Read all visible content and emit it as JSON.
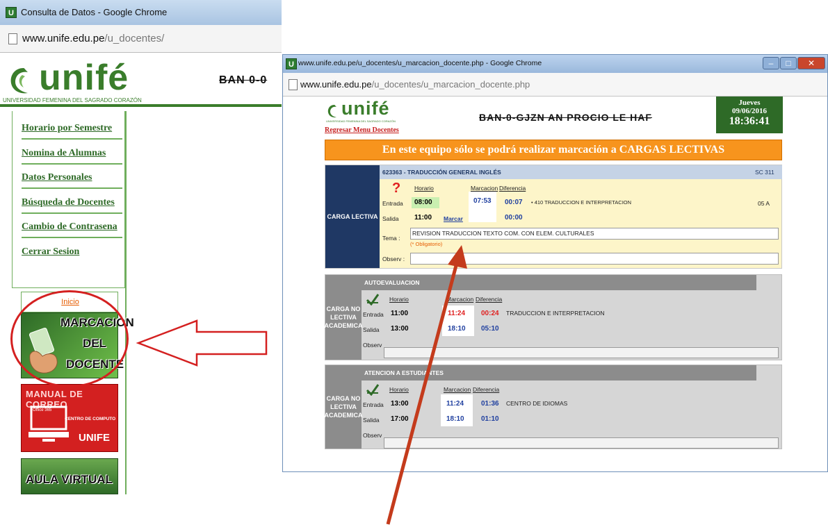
{
  "left_window": {
    "title": "Consulta de Datos - Google Chrome",
    "url_host": "www.unife.edu.pe",
    "url_path": "/u_docentes/",
    "logo_text": "unifé",
    "logo_subtitle": "UNIVERSIDAD FEMENINA DEL SAGRADO CORAZÓN",
    "banner_fragment": "BAN 0-0",
    "nav_items": [
      "Horario por Semestre",
      "Nomina de Alumnas",
      "Datos Personales",
      "Búsqueda de Docentes",
      "Cambio de Contrasena",
      "Cerrar Sesion"
    ],
    "inicio_link": "Inicio",
    "tiles": {
      "marcacion": [
        "MARCACION",
        "DEL",
        "DOCENTE"
      ],
      "manual": "MANUAL DE CORREO",
      "manual_office": "Office 365",
      "manual_centro": "CENTRO DE COMPUTO",
      "manual_unife": "UNIFE",
      "aula": "AULA VIRTUAL"
    }
  },
  "right_window": {
    "title": "www.unife.edu.pe/u_docentes/u_marcacion_docente.php - Google Chrome",
    "url_host": "www.unife.edu.pe",
    "url_path": "/u_docentes/u_marcacion_docente.php",
    "logo_text": "unifé",
    "logo_subtitle": "UNIVERSIDAD FEMENINA DEL SAGRADO CORAZÓN",
    "banner": "BAN-0-GJZN AN PROCIO LE HAF",
    "date_box": {
      "day": "Jueves",
      "date": "09/06/2016",
      "time": "18:36:41"
    },
    "back_link": "Regresar Menu Docentes",
    "notice": "En este equipo sólo se podrá realizar marcación a CARGAS LECTIVAS",
    "carga_lectiva": {
      "label": "CARGA LECTIVA",
      "course": "623363 - TRADUCCIÓN GENERAL INGLÉS",
      "room": "SC 311",
      "col_horario": "Horario",
      "col_marcacion": "Marcacion",
      "col_diferencia": "Diferencia",
      "entrada_label": "Entrada",
      "salida_label": "Salida",
      "entrada_horario": "08:00",
      "salida_horario": "11:00",
      "entrada_marcacion": "07:53",
      "entrada_diferencia": "00:07",
      "salida_diferencia": "00:00",
      "marcar_link": "Marcar",
      "program": "• 410 TRADUCCION E INTERPRETACION",
      "section": "05 A",
      "tema_label": "Tema :",
      "tema_value": "REVISION TRADUCCION TEXTO COM. CON ELEM. CULTURALES",
      "obligatorio": "(* Obligatorio)",
      "observ_label": "Observ :"
    },
    "no_lectiva_1": {
      "label": "CARGA NO LECTIVA ACADEMICA",
      "header": "AUTOEVALUACION",
      "col_horario": "Horario",
      "col_marcacion": "Marcacion",
      "col_diferencia": "Diferencia",
      "entrada_label": "Entrada",
      "salida_label": "Salida",
      "entrada_horario": "11:00",
      "salida_horario": "13:00",
      "entrada_marcacion": "11:24",
      "entrada_diferencia": "00:24",
      "salida_marcacion": "18:10",
      "salida_diferencia": "05:10",
      "description": "TRADUCCION E INTERPRETACION",
      "observ_label": "Observ"
    },
    "no_lectiva_2": {
      "label": "CARGA NO LECTIVA ACADEMICA",
      "header": "ATENCION A ESTUDIANTES",
      "col_horario": "Horario",
      "col_marcacion": "Marcacion",
      "col_diferencia": "Diferencia",
      "entrada_label": "Entrada",
      "salida_label": "Salida",
      "entrada_horario": "13:00",
      "salida_horario": "17:00",
      "entrada_marcacion": "11:24",
      "entrada_diferencia": "01:36",
      "salida_marcacion": "18:10",
      "salida_diferencia": "01:10",
      "description": "CENTRO DE IDIOMAS",
      "observ_label": "Observ"
    }
  },
  "colors": {
    "unife_green": "#3a7d2b",
    "notice_orange": "#f7941d",
    "navy_label": "#1f3864",
    "annotation_red": "#d42020"
  }
}
